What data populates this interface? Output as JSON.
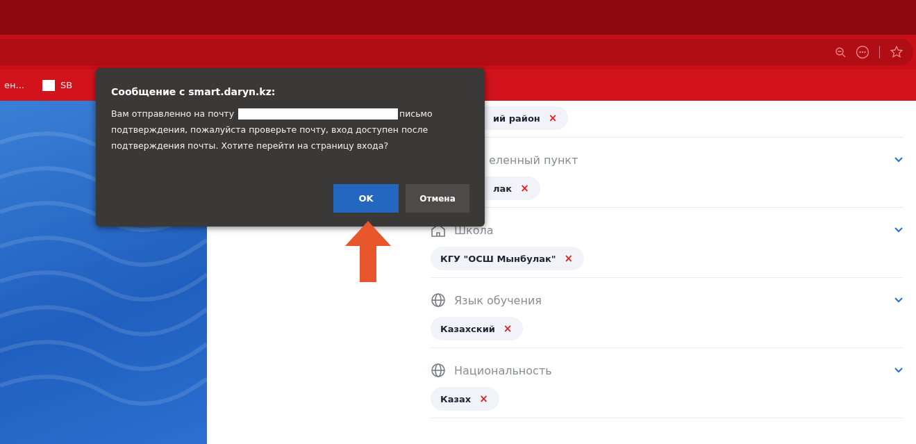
{
  "browser": {
    "bookmarks": [
      {
        "label": "ен..."
      },
      {
        "label": "SB",
        "icon": true
      }
    ]
  },
  "dialog": {
    "title": "Сообщение с smart.daryn.kz:",
    "message_before": "Вам отправленно на почту",
    "message_after": "письмо",
    "message_rest": "подтверждения, пожалуйста проверьте почту, вход доступен после подтверждения почты. Хотите перейти на страницу входа?",
    "buttons": [
      {
        "label": "OK",
        "kind": "primary"
      },
      {
        "label": "Отмена",
        "kind": "secondary"
      }
    ]
  },
  "form": {
    "sections": [
      {
        "chips": [
          {
            "label": "ий район",
            "remove": "×",
            "covered": true
          }
        ]
      },
      {
        "label": "еленный пункт",
        "covered": true,
        "chips": [
          {
            "label": "лак",
            "remove": "×",
            "covered": true
          }
        ]
      },
      {
        "label": "Школа",
        "kind": "house",
        "covered": false,
        "chips": [
          {
            "label": "КГУ \"ОСШ Мынбулак\"",
            "remove": "×",
            "covered": false
          }
        ]
      },
      {
        "label": "Язык обучения",
        "kind": "globe",
        "covered": false,
        "chips": [
          {
            "label": "Казахский",
            "remove": "×",
            "covered": false
          }
        ]
      },
      {
        "label": "Национальность",
        "kind": "globe",
        "covered": false,
        "chips": [
          {
            "label": "Казах",
            "remove": "×",
            "covered": false
          }
        ]
      }
    ]
  }
}
